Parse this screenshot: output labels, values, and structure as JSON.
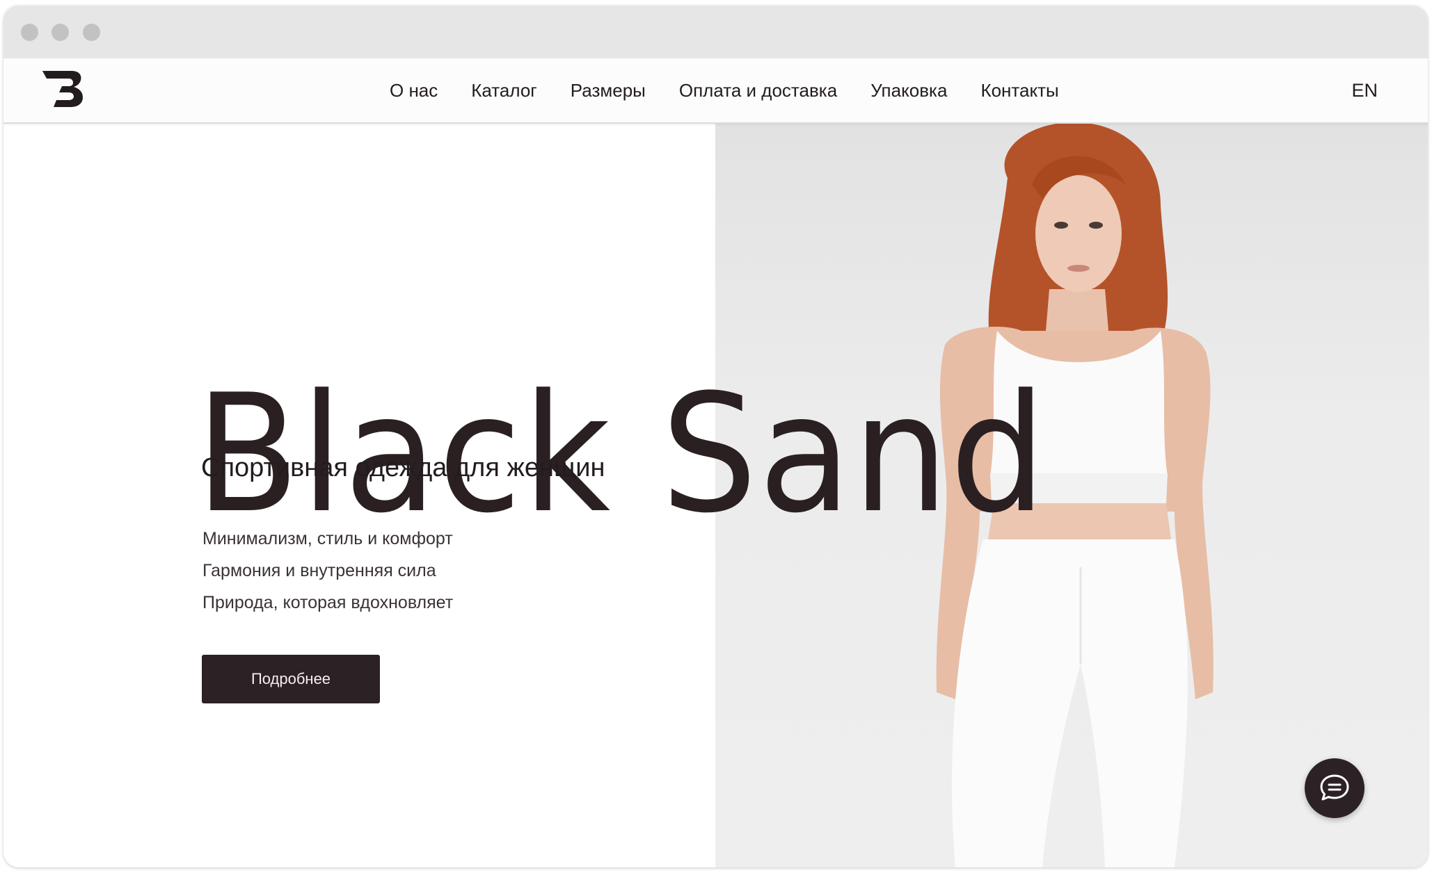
{
  "brand": {
    "logo_icon": "black-sand-b-logo-icon"
  },
  "nav": {
    "items": [
      {
        "label": "О нас"
      },
      {
        "label": "Каталог"
      },
      {
        "label": "Размеры"
      },
      {
        "label": "Оплата и доставка"
      },
      {
        "label": "Упаковка"
      },
      {
        "label": "Контакты"
      }
    ],
    "language": "EN"
  },
  "hero": {
    "title": "Black Sand",
    "subtitle": "Спортивная одежда для женщин",
    "lines": [
      "Минимализм, стиль и комфорт",
      "Гармония и внутренняя сила",
      "Природа, которая вдохновляет"
    ],
    "button_label": "Подробнее",
    "image": "model-in-white-sportswear-photo"
  },
  "chat": {
    "icon": "chat-bubble-icon"
  },
  "colors": {
    "primary_dark": "#2c2124",
    "text": "#231c1e",
    "image_background": "#ececec"
  }
}
